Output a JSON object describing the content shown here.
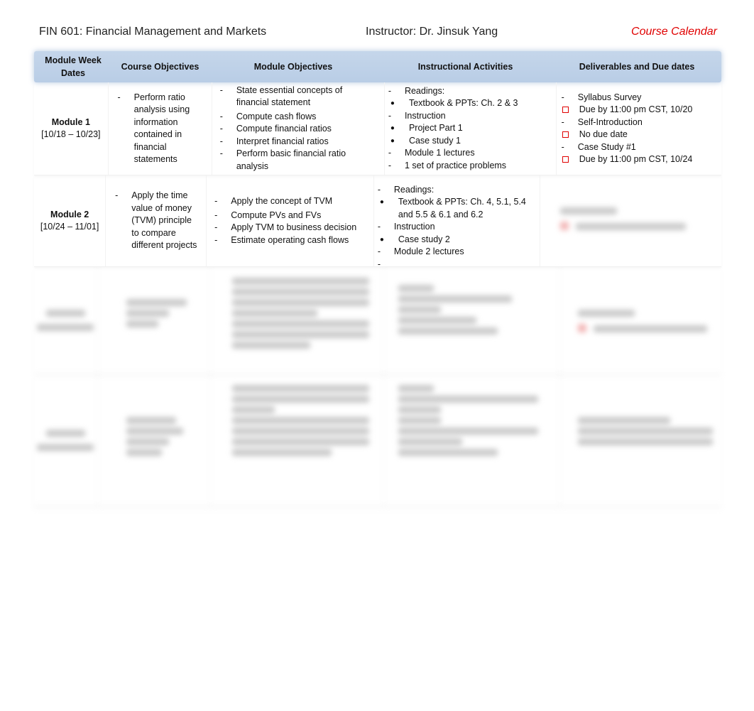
{
  "header": {
    "course_title": "FIN 601: Financial Management and Markets",
    "instructor": "Instructor: Dr. Jinsuk Yang",
    "doc_label": "Course Calendar"
  },
  "colors": {
    "accent_red": "#e00000",
    "header_blue": "#c5d6ea"
  },
  "table": {
    "columns": [
      "Module Week Dates",
      "Course Objectives",
      "Module Objectives",
      "Instructional Activities",
      "Deliverables and Due dates"
    ],
    "rows": [
      {
        "module": "Module 1",
        "dates": "[10/18 – 10/23]",
        "course_objectives": [
          "Perform ratio analysis using information contained in financial statements"
        ],
        "module_objectives": [
          "State essential concepts of financial statement",
          "Compute cash flows",
          "Compute financial ratios",
          "Interpret financial ratios",
          "Perform basic financial ratio analysis"
        ],
        "activities": [
          {
            "type": "dash",
            "text": "Readings:"
          },
          {
            "type": "bullet",
            "text": "Textbook & PPTs: Ch. 2 & 3"
          },
          {
            "type": "dash",
            "text": "Instruction"
          },
          {
            "type": "bullet",
            "text": "Project Part 1"
          },
          {
            "type": "bullet",
            "text": "Case study 1"
          },
          {
            "type": "dash",
            "text": "Module 1 lectures"
          },
          {
            "type": "dash",
            "text": "1 set of practice problems"
          }
        ],
        "deliverables": [
          {
            "type": "dash",
            "text": "Syllabus Survey"
          },
          {
            "type": "box",
            "text": "Due by 11:00 pm CST, 10/20"
          },
          {
            "type": "dash",
            "text": "Self-Introduction"
          },
          {
            "type": "box",
            "text": "No due date"
          },
          {
            "type": "dash",
            "text": "Case Study #1"
          },
          {
            "type": "box",
            "text": "Due by 11:00 pm CST, 10/24"
          }
        ]
      },
      {
        "module": "Module 2",
        "dates": "[10/24 – 11/01]",
        "course_objectives": [
          "Apply the time value of money (TVM) principle to compare different projects"
        ],
        "module_objectives": [
          "Apply the concept of TVM",
          "Compute PVs and FVs",
          "Apply TVM to business decision",
          "Estimate operating cash flows"
        ],
        "activities": [
          {
            "type": "dash",
            "text": "Readings:"
          },
          {
            "type": "bullet",
            "text": "Textbook & PPTs: Ch. 4, 5.1, 5.4 and 5.5 & 6.1 and 6.2"
          },
          {
            "type": "dash",
            "text": "Instruction"
          },
          {
            "type": "bullet",
            "text": "Case study 2"
          },
          {
            "type": "dash",
            "text": "Module 2 lectures"
          },
          {
            "type": "dash",
            "text": ""
          }
        ],
        "deliverables": []
      }
    ]
  }
}
